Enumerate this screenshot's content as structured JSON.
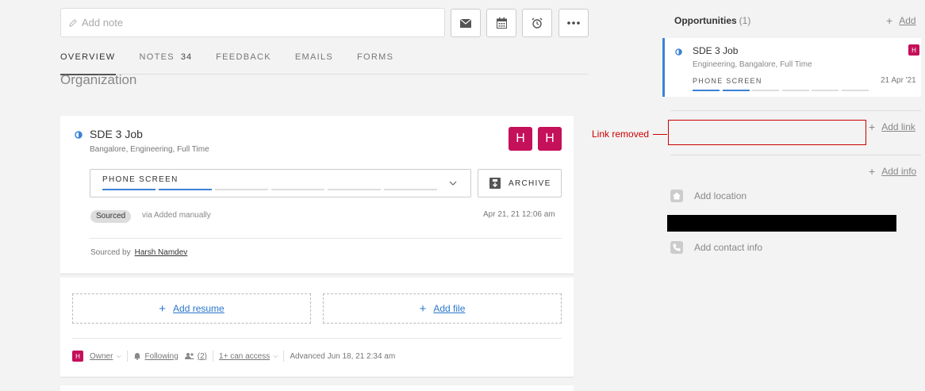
{
  "note": {
    "placeholder": "Add note"
  },
  "toolbar": {
    "email_icon": "envelope-icon",
    "calendar_icon": "calendar-icon",
    "alarm_icon": "alarm-clock-icon",
    "more_icon": "ellipsis-icon"
  },
  "tabs": [
    {
      "label": "OVERVIEW",
      "active": true
    },
    {
      "label": "NOTES",
      "count": "34"
    },
    {
      "label": "FEEDBACK"
    },
    {
      "label": "EMAILS"
    },
    {
      "label": "FORMS"
    }
  ],
  "section": {
    "heading": "Organization"
  },
  "job": {
    "title": "SDE 3 Job",
    "subtitle": "Bangalore, Engineering, Full Time",
    "avatars": [
      "H",
      "H"
    ],
    "stage": "PHONE SCREEN",
    "stages_total": 6,
    "stages_done": 2,
    "archive_label": "ARCHIVE",
    "badge": "Sourced",
    "via": "via Added manually",
    "timestamp": "Apr 21, 21 12:06 am",
    "sourced_by_label": "Sourced by",
    "sourced_by_name": "Harsh Namdev"
  },
  "attachments": {
    "add_resume": "Add resume",
    "add_file": "Add file"
  },
  "footer": {
    "avatar": "H",
    "owner": "Owner",
    "following": "Following",
    "followers": "(2)",
    "access": "1+ can access",
    "advanced": "Advanced Jun 18, 21 2:34 am"
  },
  "sidebar": {
    "opportunities_title": "Opportunities",
    "opportunities_count": "(1)",
    "add_label": "Add",
    "opp": {
      "title": "SDE 3 Job",
      "subtitle": "Engineering, Bangalore, Full Time",
      "stage": "PHONE SCREEN",
      "date": "21 Apr '21",
      "avatar": "H"
    },
    "redaction_label": "Link removed",
    "add_link": "Add link",
    "add_info": "Add info",
    "add_location": "Add location",
    "add_contact": "Add contact info"
  },
  "colors": {
    "accent": "#3b82d6",
    "avatar": "#c5105a",
    "redaction": "#cc0000"
  }
}
